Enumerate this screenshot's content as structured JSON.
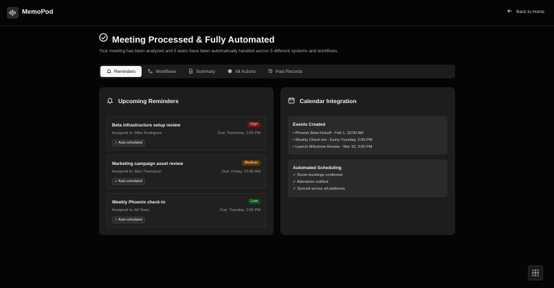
{
  "app": {
    "name": "MemoPod",
    "back_label": "Back to Home"
  },
  "page": {
    "title": "Meeting Processed & Fully Automated",
    "subtitle": "Your meeting has been analyzed and 5 tasks have been automatically handled across 5 different systems and workflows."
  },
  "tabs": [
    {
      "label": "Reminders",
      "icon": "bell-icon",
      "active": true
    },
    {
      "label": "Workflows",
      "icon": "workflow-icon",
      "active": false
    },
    {
      "label": "Summary",
      "icon": "document-icon",
      "active": false
    },
    {
      "label": "All Actions",
      "icon": "circle-icon",
      "active": false
    },
    {
      "label": "Past Records",
      "icon": "history-icon",
      "active": false
    }
  ],
  "reminders": {
    "heading": "Upcoming Reminders",
    "items": [
      {
        "title": "Beta infrastructure setup review",
        "priority": "High",
        "assigned": "Assigned to: Mike Rodriguez",
        "due": "Due: Tomorrow, 2:00 PM",
        "chip": "✓ Auto-scheduled"
      },
      {
        "title": "Marketing campaign asset review",
        "priority": "Medium",
        "assigned": "Assigned to: Alex Thompson",
        "due": "Due: Friday, 10:00 AM",
        "chip": "✓ Auto-scheduled"
      },
      {
        "title": "Weekly Phoenix check-in",
        "priority": "Low",
        "assigned": "Assigned to: All Team",
        "due": "Due: Tuesday, 2:00 PM",
        "chip": "✓ Auto-scheduled"
      }
    ]
  },
  "calendar": {
    "heading": "Calendar Integration",
    "events": {
      "title": "Events Created",
      "lines": [
        "• Phoenix Beta Kickoff - Feb 1, 10:00 AM",
        "• Weekly Check-ins - Every Tuesday, 2:00 PM",
        "• Launch Milestone Review - Mar 10, 3:00 PM"
      ]
    },
    "scheduling": {
      "title": "Automated Scheduling",
      "lines": [
        "✓ Room bookings confirmed",
        "✓ Attendees notified",
        "✓ Synced across all platforms"
      ]
    }
  },
  "colors": {
    "background": "#050505",
    "card": "#1d1d1d",
    "high": "#ff8a8a",
    "medium": "#ffb650",
    "low": "#76e08d"
  }
}
